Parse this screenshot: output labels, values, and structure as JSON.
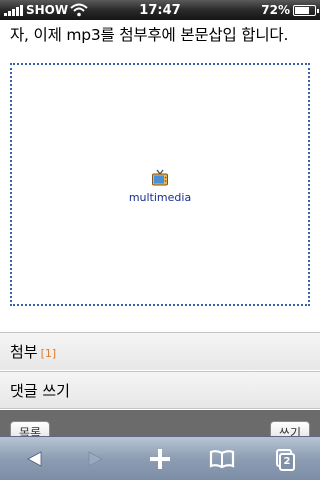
{
  "status": {
    "carrier": "SHOW",
    "time": "17:47",
    "battery_percent": "72%",
    "battery_level": 0.72,
    "signal_bars": 5
  },
  "post": {
    "text": "자, 이제 mp3를 첨부후에 본문삽입 합니다."
  },
  "media": {
    "label": "multimedia",
    "icon": "tv-icon"
  },
  "rows": {
    "attach_label": "첨부",
    "attach_count": "[1]",
    "comment_label": "댓글 쓰기"
  },
  "buttons": {
    "list_label": "목록",
    "write_label": "쓰기"
  },
  "toolbar": {
    "pages_count": "2",
    "icons": [
      "back-arrow-icon",
      "forward-arrow-icon",
      "add-icon",
      "bookmarks-icon",
      "pages-icon"
    ]
  },
  "colors": {
    "editor_border": "#3a5fa6",
    "count_accent": "#e07b2a",
    "media_label": "#1a2f8f"
  }
}
